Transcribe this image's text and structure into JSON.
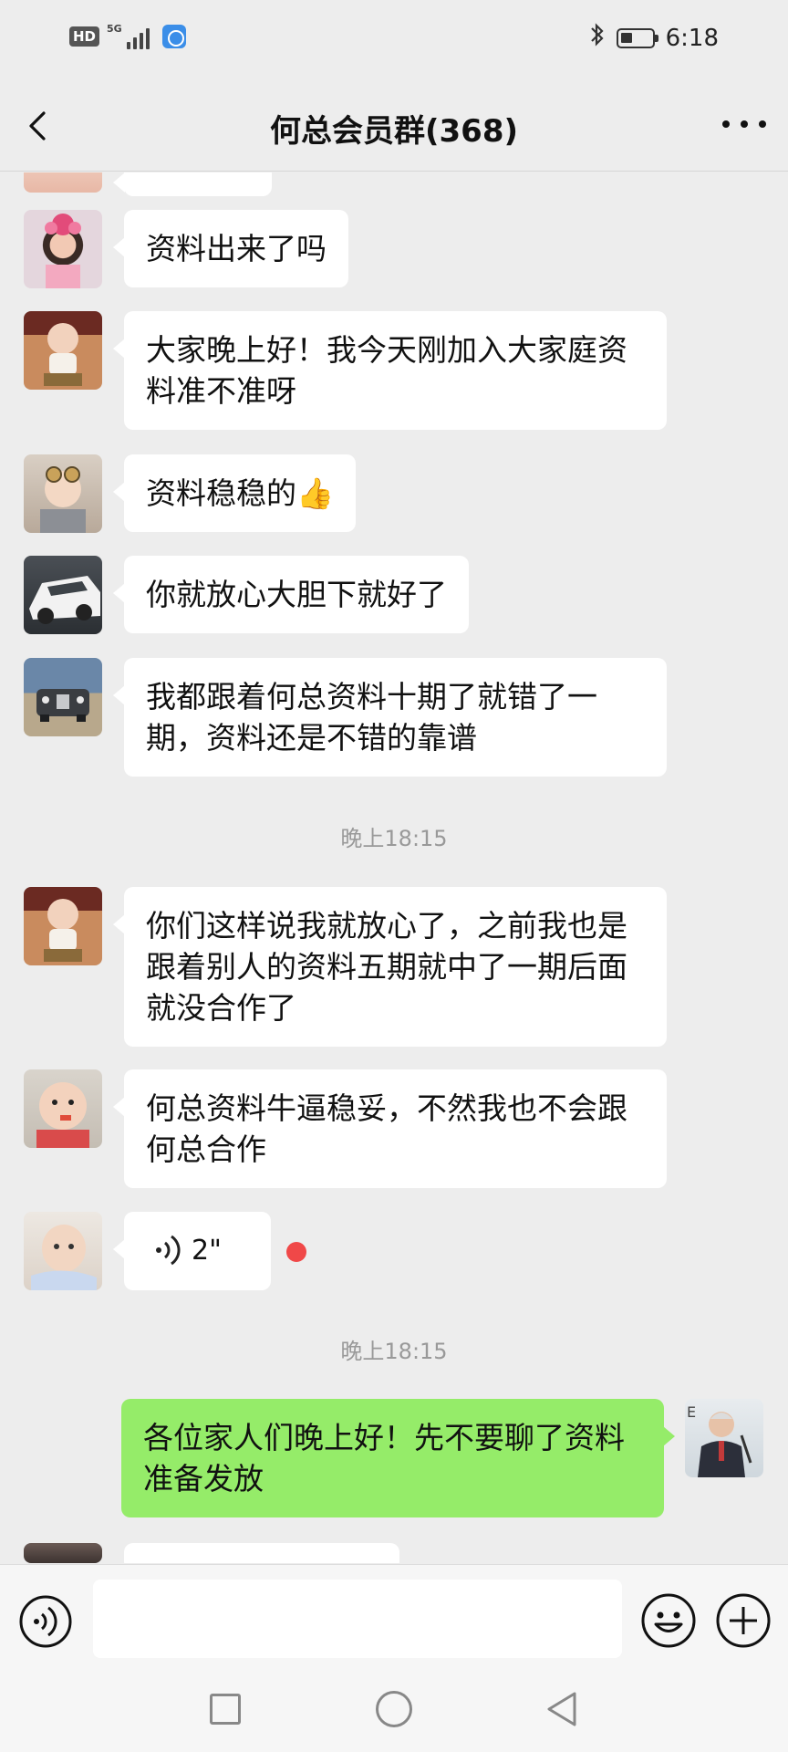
{
  "status_bar": {
    "hd_label": "HD",
    "network_label": "5G",
    "time": "6:18",
    "icons": [
      "hd-icon",
      "signal-icon",
      "network-app-icon",
      "bluetooth-icon",
      "battery-icon"
    ]
  },
  "header": {
    "title": "何总会员群(368)",
    "back_icon": "chevron-left-icon",
    "more_icon": "more-dots-icon"
  },
  "messages": [
    {
      "side": "left",
      "avatar": "avatar-girl-flower-headband",
      "text": "资料出来了吗"
    },
    {
      "side": "left",
      "avatar": "avatar-baby-sitting",
      "text": "大家晚上好！我今天刚加入大家庭资料准不准呀"
    },
    {
      "side": "left",
      "avatar": "avatar-baby-goggles",
      "text": "资料稳稳的👍"
    },
    {
      "side": "left",
      "avatar": "avatar-white-sports-car",
      "text": "你就放心大胆下就好了"
    },
    {
      "side": "left",
      "avatar": "avatar-luxury-car-front",
      "text": "我都跟着何总资料十期了就错了一期，资料还是不错的靠谱"
    },
    {
      "type": "timestamp",
      "text": "晚上18:15"
    },
    {
      "side": "left",
      "avatar": "avatar-baby-sitting",
      "text": "你们这样说我就放心了，之前我也是跟着别人的资料五期就中了一期后面就没合作了"
    },
    {
      "side": "left",
      "avatar": "avatar-baby-pacifier",
      "text": "何总资料牛逼稳妥，不然我也不会跟何总合作"
    },
    {
      "side": "left",
      "type": "voice",
      "avatar": "avatar-baby-lying",
      "duration": "2\"",
      "unread": true
    },
    {
      "type": "timestamp",
      "text": "晚上18:15"
    },
    {
      "side": "right",
      "avatar": "avatar-man-speaker",
      "text": "各位家人们晚上好！先不要聊了资料准备发放"
    }
  ],
  "input_bar": {
    "placeholder": "",
    "voice_icon": "voice-input-icon",
    "emoji_icon": "emoji-icon",
    "plus_icon": "plus-icon"
  },
  "colors": {
    "background": "#ededed",
    "bubble_left": "#ffffff",
    "bubble_right": "#95ec69",
    "unread": "#f04848",
    "timestamp": "#999999"
  }
}
